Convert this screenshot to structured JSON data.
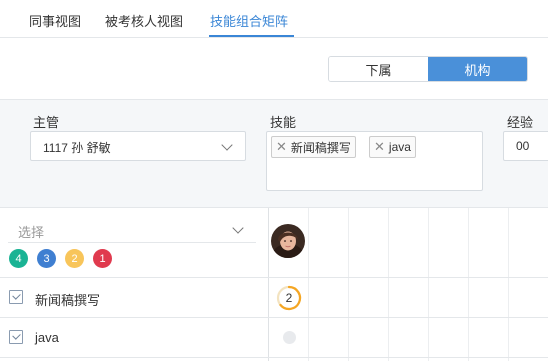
{
  "tabs": [
    {
      "label": "同事视图",
      "active": false
    },
    {
      "label": "被考核人视图",
      "active": false
    },
    {
      "label": "技能组合矩阵",
      "active": true
    }
  ],
  "toggle": {
    "options": [
      "下属",
      "机构"
    ],
    "selected": "机构"
  },
  "filters": {
    "manager": {
      "label": "主管",
      "value": "1117 孙 舒敏"
    },
    "skills": {
      "label": "技能",
      "tags": [
        "新闻稿撰写",
        "java"
      ]
    },
    "experience": {
      "label": "经验",
      "value": "00"
    }
  },
  "matrix": {
    "select_placeholder": "选择",
    "legend": [
      {
        "value": "4",
        "color": "#1ab394"
      },
      {
        "value": "3",
        "color": "#3f7fd1"
      },
      {
        "value": "2",
        "color": "#f8c55a"
      },
      {
        "value": "1",
        "color": "#e03a4e"
      }
    ],
    "rows": [
      {
        "skill": "新闻稿撰写",
        "rating": "2",
        "ring_color": "#f5a623"
      },
      {
        "skill": "java",
        "rating": null
      }
    ]
  }
}
